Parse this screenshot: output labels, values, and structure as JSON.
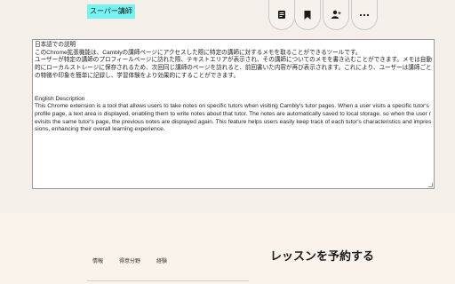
{
  "header": {
    "badge_label": "スーパー講師",
    "icons": [
      "note-icon",
      "bookmark-icon",
      "person-add-icon",
      "more-icon"
    ]
  },
  "notes": {
    "text_lines": [
      "日本語での説明",
      "このChrome拡張機能は、Camblyの講師ページにアクセスした際に特定の講師に対するメモを取ることができるツールです。",
      "ユーザーが特定の講師のプロフィールページに訪れた際、テキストエリアが表示され、その講師についてのメモを書き込むことができます。メモは自動的にローカルストレージに保存されるため、次回同じ講師のページを訪れると、前回書いた内容が再び表示されます。これにより、ユーザーは講師ごとの特徴や印象を簡単に記録し、学習体験をより効果的にすることができます。",
      "",
      "English Description",
      "This Chrome extension is a tool that allows users to take notes on specific tutors when visiting Cambly's tutor pages. When a user visits a specific tutor's profile page, a text area is displayed, enabling them to write notes about that tutor. The notes are automatically saved to local storage, so when the user revisits the same tutor's page, the previous notes are displayed again. This feature helps users easily keep track of each tutor's characteristics and impressions, enhancing their overall learning experience."
    ]
  },
  "tabs": [
    "情報",
    "得意分野",
    "経験"
  ],
  "booking": {
    "heading": "レッスンを予約する"
  }
}
